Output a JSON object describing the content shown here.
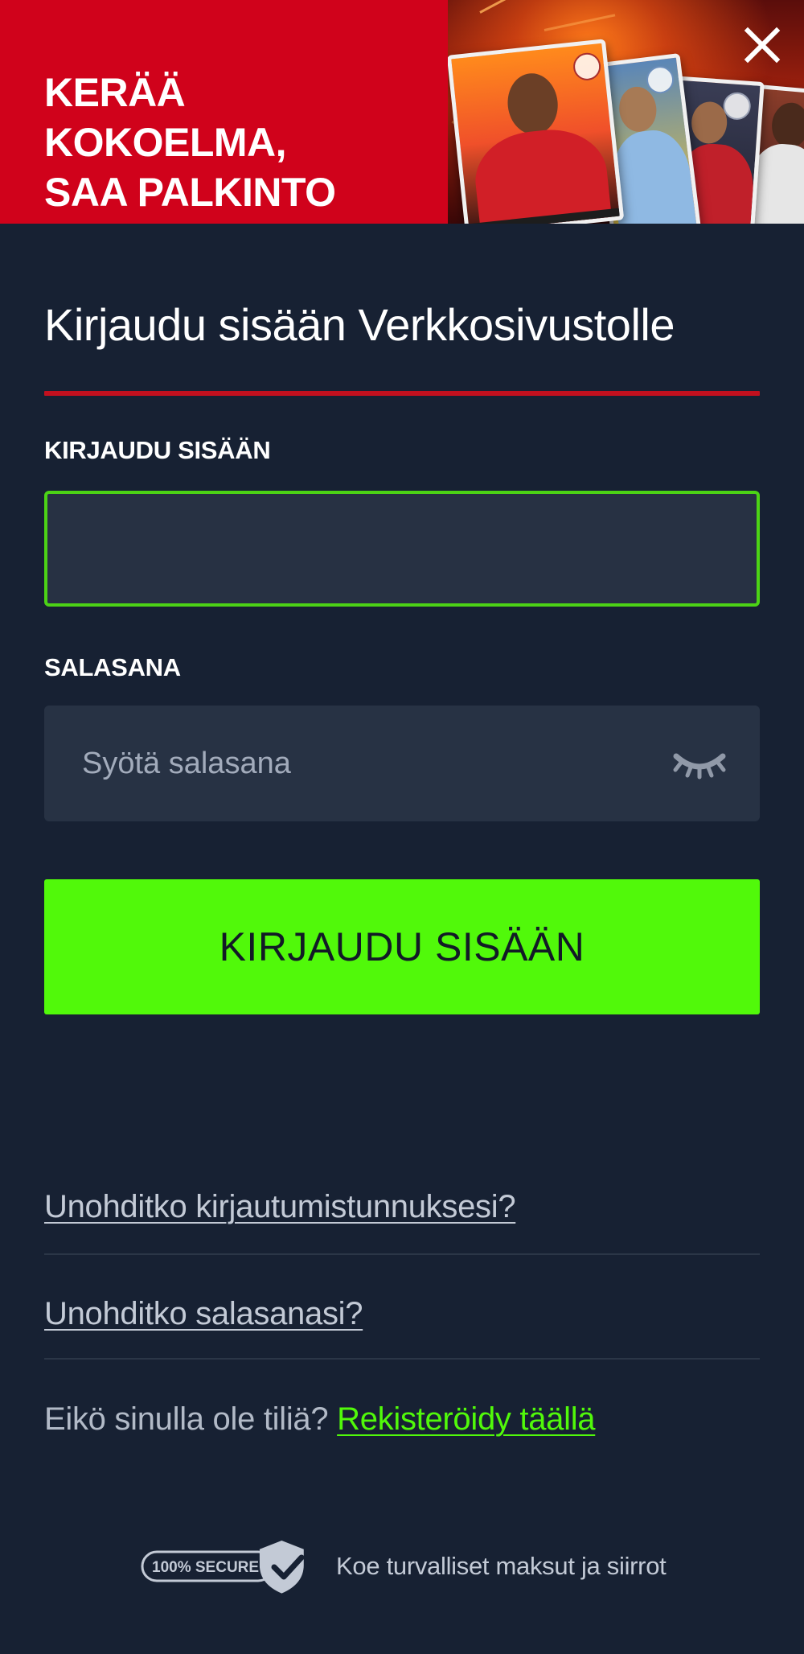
{
  "promo_banner": {
    "title_lines": [
      "KERÄÄ KOKOELMA,",
      "SAA PALKINTO"
    ],
    "close_icon": "close-icon",
    "colors": {
      "background": "#d0021b",
      "text": "#ffffff"
    }
  },
  "login_form": {
    "title": "Kirjaudu sisään Verkkosivustolle",
    "username": {
      "label": "KIRJAUDU SISÄÄN",
      "value": "",
      "placeholder": ""
    },
    "password": {
      "label": "SALASANA",
      "value": "",
      "placeholder": "Syötä salasana",
      "toggle_icon": "eye-closed-icon"
    },
    "submit_label": "KIRJAUDU SISÄÄN"
  },
  "help_links": {
    "forgot_username": "Unohditko kirjautumistunnuksesi?",
    "forgot_password": "Unohditko salasanasi?"
  },
  "register": {
    "prompt": "Eikö sinulla ole tiliä?",
    "link_label": "Rekisteröidy täällä"
  },
  "secure_footer": {
    "badge_text": "100% SECURE",
    "text": "Koe turvalliset maksut ja siirrot",
    "badge_icon": "shield-check-icon"
  },
  "colors": {
    "page_background": "#172133",
    "input_background": "#273244",
    "accent_green": "#51f90a",
    "active_border": "#4cd316",
    "divider_red": "#c2101e"
  }
}
